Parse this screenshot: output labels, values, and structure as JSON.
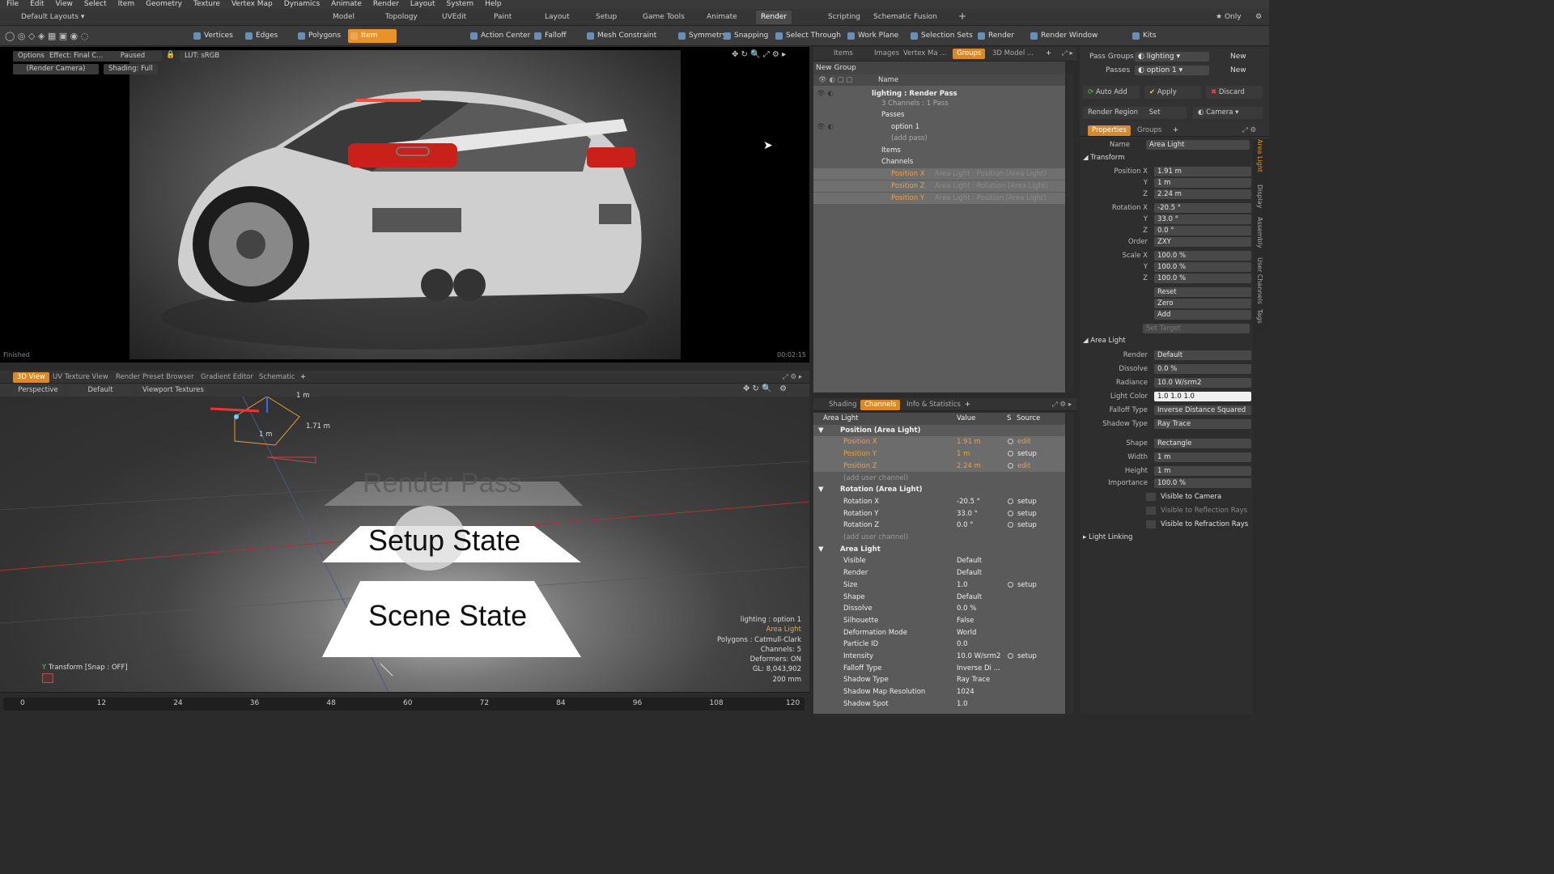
{
  "menu": [
    "File",
    "Edit",
    "View",
    "Select",
    "Item",
    "Geometry",
    "Texture",
    "Vertex Map",
    "Dynamics",
    "Animate",
    "Render",
    "Layout",
    "System",
    "Help"
  ],
  "layouts": {
    "label": "Default Layouts",
    "tabs": [
      "Model",
      "Topology",
      "UVEdit",
      "Paint",
      "Layout",
      "Setup",
      "Game Tools",
      "Animate",
      "Render",
      "Scripting",
      "Schematic Fusion"
    ],
    "active": "Render",
    "only": "Only"
  },
  "toolbar": [
    "Vertices",
    "Edges",
    "Polygons",
    "Item",
    "Action Center",
    "Falloff",
    "Mesh Constraint",
    "Symmetry",
    "Snapping",
    "Select Through",
    "Work Plane",
    "Selection Sets",
    "Render",
    "Render Window",
    "Kits"
  ],
  "render_view": {
    "options": "Options",
    "effect": "Effect: Final C...",
    "paused": "Paused",
    "lut": "LUT: sRGB",
    "camera": "(Render Camera)",
    "shading": "Shading: Full",
    "status": "Finished",
    "time": "00:02:15"
  },
  "bottom_tabs": [
    "3D View",
    "UV Texture View",
    "Render Preset Browser",
    "Gradient Editor",
    "Schematic"
  ],
  "view3d": {
    "perspective": "Perspective",
    "default": "Default",
    "textures": "Viewport Textures",
    "dim1": "1 m",
    "dim2": "1 m",
    "dim3": "1.71 m",
    "title": "Render Pass",
    "setup": "Setup State",
    "scene": "Scene State",
    "info": [
      "lighting : option 1",
      "Area Light",
      "Polygons : Catmull-Clark",
      "Channels: 5",
      "Deformers: ON",
      "GL: 8,043,902",
      "200 mm"
    ],
    "transform": "Transform  [Snap : OFF]"
  },
  "timeline": [
    "0",
    "12",
    "24",
    "36",
    "48",
    "60",
    "72",
    "84",
    "96",
    "108",
    "120"
  ],
  "groups_tabs": [
    "Items",
    "Images",
    "Vertex Ma ...",
    "Groups",
    "3D Model ..."
  ],
  "groups": {
    "new_group": "New Group",
    "name_col": "Name",
    "rows": [
      {
        "t": "lighting : Render Pass",
        "d": 1,
        "b": true
      },
      {
        "t": "3 Channels : 1 Pass",
        "d": 2,
        "b": false
      },
      {
        "t": "Passes",
        "d": 2,
        "b": false
      },
      {
        "t": "option 1",
        "d": 3,
        "b": false
      },
      {
        "t": "(add pass)",
        "d": 3,
        "b": false
      },
      {
        "t": "Items",
        "d": 2,
        "b": false
      },
      {
        "t": "Channels",
        "d": 2,
        "b": false
      },
      {
        "t": "Position X",
        "d": 3,
        "b": false,
        "o": "Area Light : Position (Area Light)"
      },
      {
        "t": "Position Z",
        "d": 3,
        "b": false,
        "o": "Area Light : Rotation (Area Light)"
      },
      {
        "t": "Position Y",
        "d": 3,
        "b": false,
        "o": "Area Light : Position (Area Light)"
      }
    ]
  },
  "chan_tabs": [
    "Shading",
    "Channels",
    "Info & Statistics"
  ],
  "channels": {
    "cols": [
      "Area Light",
      "Value",
      "S",
      "Source"
    ],
    "rows": [
      {
        "n": "Position (Area Light)",
        "g": true
      },
      {
        "n": "Position X",
        "v": "1.91 m",
        "src": "edit",
        "o": true
      },
      {
        "n": "Position Y",
        "v": "1 m",
        "src": "setup",
        "o": true
      },
      {
        "n": "Position Z",
        "v": "2.24 m",
        "src": "edit",
        "o": true
      },
      {
        "n": "(add user channel)",
        "dim": true
      },
      {
        "n": "Rotation (Area Light)",
        "g": true
      },
      {
        "n": "Rotation X",
        "v": "-20.5 °",
        "src": "setup"
      },
      {
        "n": "Rotation Y",
        "v": "33.0 °",
        "src": "setup"
      },
      {
        "n": "Rotation Z",
        "v": "0.0 °",
        "src": "setup"
      },
      {
        "n": "(add user channel)",
        "dim": true
      },
      {
        "n": "Area Light",
        "g": true
      },
      {
        "n": "Visible",
        "v": "Default"
      },
      {
        "n": "Render",
        "v": "Default"
      },
      {
        "n": "Size",
        "v": "1.0",
        "src": "setup"
      },
      {
        "n": "Shape",
        "v": "Default"
      },
      {
        "n": "Dissolve",
        "v": "0.0 %"
      },
      {
        "n": "Silhouette",
        "v": "False"
      },
      {
        "n": "Deformation Mode",
        "v": "World"
      },
      {
        "n": "Particle ID",
        "v": "0.0"
      },
      {
        "n": "Intensity",
        "v": "10.0 W/srm2",
        "src": "setup"
      },
      {
        "n": "Falloff Type",
        "v": "Inverse Di ..."
      },
      {
        "n": "Shadow Type",
        "v": "Ray Trace"
      },
      {
        "n": "Shadow Map Resolution",
        "v": "1024"
      },
      {
        "n": "Shadow Spot",
        "v": "1.0"
      }
    ]
  },
  "pass": {
    "pass_groups": "Pass Groups",
    "lighting": "lighting",
    "passes": "Passes",
    "option": "option 1",
    "new": "New",
    "auto_add": "Auto Add",
    "apply": "Apply",
    "discard": "Discard",
    "render_region": "Render Region",
    "set": "Set",
    "camera": "Camera"
  },
  "props_tabs": [
    "Properties",
    "Groups"
  ],
  "props": {
    "name_label": "Name",
    "name": "Area Light",
    "transform": "Transform",
    "rows": [
      [
        "Position X",
        "1.91 m"
      ],
      [
        "Y",
        "1 m"
      ],
      [
        "Z",
        "2.24 m"
      ],
      [
        "Rotation X",
        "-20.5 °"
      ],
      [
        "Y",
        "33.0 °"
      ],
      [
        "Z",
        "0.0 °"
      ],
      [
        "Order",
        "ZXY"
      ],
      [
        "Scale X",
        "100.0 %"
      ],
      [
        "Y",
        "100.0 %"
      ],
      [
        "Z",
        "100.0 %"
      ],
      [
        "",
        "Reset"
      ],
      [
        "",
        "Zero"
      ],
      [
        "",
        "Add"
      ],
      [
        "",
        "Set Target"
      ]
    ],
    "area": "Area Light",
    "arows": [
      [
        "Render",
        "Default"
      ],
      [
        "Dissolve",
        "0.0 %"
      ],
      [
        "Radiance",
        "10.0 W/srm2"
      ],
      [
        "Light Color",
        "1.0        1.0        1.0"
      ],
      [
        "Falloff Type",
        "Inverse Distance Squared"
      ],
      [
        "Shadow Type",
        "Ray Trace"
      ],
      [
        "Shape",
        "Rectangle"
      ],
      [
        "Width",
        "1 m"
      ],
      [
        "Height",
        "1 m"
      ],
      [
        "Importance",
        "100.0 %"
      ],
      [
        "",
        "Visible to Camera"
      ],
      [
        "",
        "Visible to Reflection Rays"
      ],
      [
        "",
        "Visible to Refraction Rays"
      ]
    ],
    "linking": "Light Linking"
  },
  "vtabs": [
    "Area Light",
    "Display",
    "Assembly",
    "User Channels",
    "Tags"
  ]
}
